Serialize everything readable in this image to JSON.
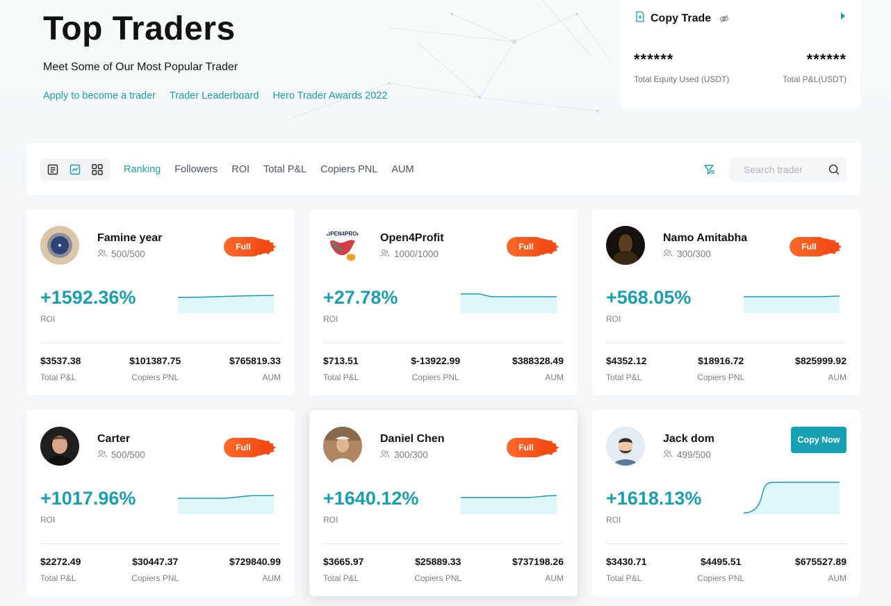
{
  "hero": {
    "title": "Top Traders",
    "subtitle": "Meet Some of Our Most Popular Trader",
    "links": [
      "Apply to become a trader",
      "Trader Leaderboard",
      "Hero Trader Awards 2022"
    ]
  },
  "copy_panel": {
    "title": "Copy Trade",
    "equity_value": "******",
    "equity_label": "Total Equity Used (USDT)",
    "pnl_value": "******",
    "pnl_label": "Total P&L(USDT)"
  },
  "toolbar": {
    "sort_tabs": [
      "Ranking",
      "Followers",
      "ROI",
      "Total P&L",
      "Copiers PNL",
      "AUM"
    ],
    "active_tab": "Ranking",
    "search_placeholder": "Search trader"
  },
  "labels": {
    "roi": "ROI",
    "total_pnl": "Total P&L",
    "copiers_pnl": "Copiers PNL",
    "aum": "AUM",
    "full": "Full",
    "copy_now": "Copy Now"
  },
  "colors": {
    "accent": "#1a9fae",
    "full_badge": "#f24c14",
    "copy_button": "#17a2b3"
  },
  "traders": [
    {
      "name": "Famine year",
      "followers": "500/500",
      "roi": "+1592.36%",
      "total_pnl": "$3537.38",
      "copiers_pnl": "$101387.75",
      "aum": "$765819.33",
      "status": "Full"
    },
    {
      "name": "Open4Profit",
      "followers": "1000/1000",
      "roi": "+27.78%",
      "total_pnl": "$713.51",
      "copiers_pnl": "$-13922.99",
      "aum": "$388328.49",
      "status": "Full"
    },
    {
      "name": "Namo Amitabha",
      "followers": "300/300",
      "roi": "+568.05%",
      "total_pnl": "$4352.12",
      "copiers_pnl": "$18916.72",
      "aum": "$825999.92",
      "status": "Full"
    },
    {
      "name": "Carter",
      "followers": "500/500",
      "roi": "+1017.96%",
      "total_pnl": "$2272.49",
      "copiers_pnl": "$30447.37",
      "aum": "$729840.99",
      "status": "Full"
    },
    {
      "name": "Daniel Chen",
      "followers": "300/300",
      "roi": "+1640.12%",
      "total_pnl": "$3665.97",
      "copiers_pnl": "$25889.33",
      "aum": "$737198.26",
      "status": "Full"
    },
    {
      "name": "Jack dom",
      "followers": "499/500",
      "roi": "+1618.13%",
      "total_pnl": "$3430.71",
      "copiers_pnl": "$4495.51",
      "aum": "$675527.89",
      "status": "Copy Now"
    }
  ]
}
